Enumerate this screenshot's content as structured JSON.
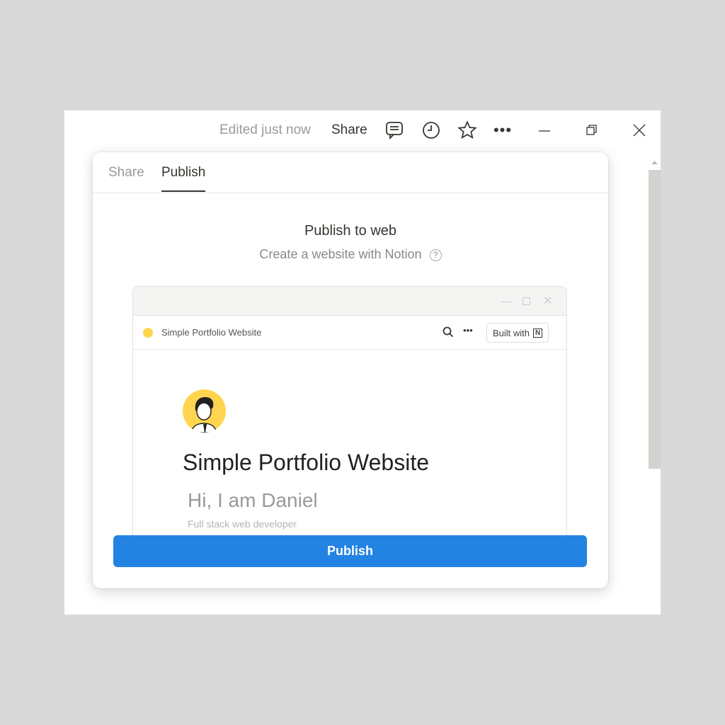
{
  "topbar": {
    "edited": "Edited just now",
    "share": "Share"
  },
  "popover": {
    "tabs": [
      {
        "label": "Share",
        "active": false
      },
      {
        "label": "Publish",
        "active": true
      }
    ],
    "title": "Publish to web",
    "subtitle": "Create a website with Notion",
    "preview": {
      "site_name": "Simple Portfolio Website",
      "built_with": "Built with",
      "page_title": "Simple Portfolio Website",
      "heading": "Hi, I am Daniel",
      "tagline": "Full stack web developer"
    },
    "publish_button": "Publish"
  },
  "colors": {
    "accent": "#2383e2",
    "avatar": "#ffd54f"
  }
}
